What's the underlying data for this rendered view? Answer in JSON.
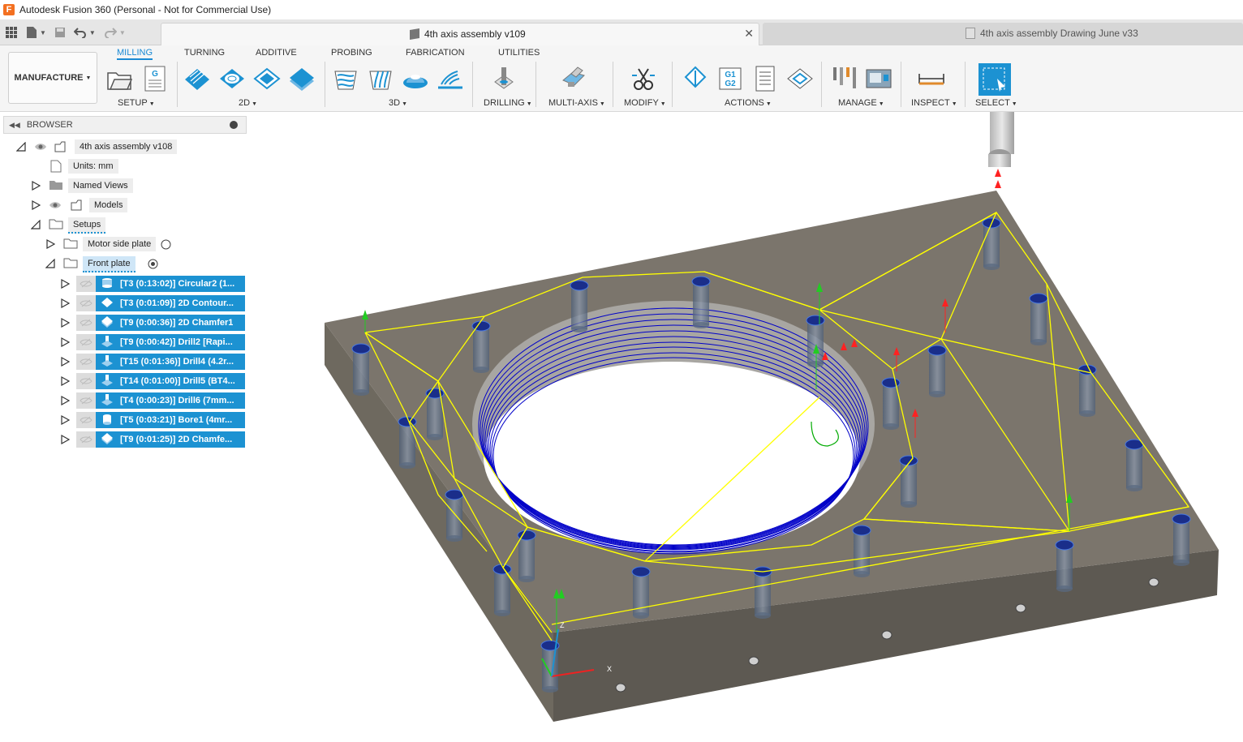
{
  "window": {
    "app_title": "Autodesk Fusion 360 (Personal - Not for Commercial Use)",
    "app_logo_letter": "F"
  },
  "tabs": {
    "active_doc": "4th axis assembly v109",
    "inactive_doc": "4th axis assembly Drawing June v33",
    "close_glyph": "✕"
  },
  "ribbon": {
    "workspace": "MANUFACTURE",
    "tabs": [
      "MILLING",
      "TURNING",
      "ADDITIVE",
      "PROBING",
      "FABRICATION",
      "UTILITIES"
    ],
    "groups": [
      "SETUP",
      "2D",
      "3D",
      "DRILLING",
      "MULTI-AXIS",
      "MODIFY",
      "ACTIONS",
      "MANAGE",
      "INSPECT",
      "SELECT"
    ],
    "actions_g_label": "G1\nG2"
  },
  "browser": {
    "header": "BROWSER",
    "root": "4th axis assembly v108",
    "units": "Units: mm",
    "named_views": "Named Views",
    "models": "Models",
    "setups": "Setups",
    "setup_1": "Motor side plate",
    "setup_2": "Front plate",
    "operations": [
      {
        "label": "[T3 (0:13:02)] Circular2 (1...",
        "icon": "circular-icon"
      },
      {
        "label": "[T3 (0:01:09)] 2D Contour...",
        "icon": "contour-icon"
      },
      {
        "label": "[T9 (0:00:36)] 2D Chamfer1",
        "icon": "chamfer-icon"
      },
      {
        "label": "[T9 (0:00:42)] Drill2 [Rapi...",
        "icon": "drill-icon"
      },
      {
        "label": "[T15 (0:01:36)] Drill4 (4.2r...",
        "icon": "drill-icon"
      },
      {
        "label": "[T14 (0:01:00)] Drill5 (BT4...",
        "icon": "drill-icon"
      },
      {
        "label": "[T4 (0:00:23)] Drill6 (7mm...",
        "icon": "drill-icon"
      },
      {
        "label": "[T5 (0:03:21)] Bore1 (4mr...",
        "icon": "bore-icon"
      },
      {
        "label": "[T9 (0:01:25)] 2D Chamfe...",
        "icon": "chamfer-icon"
      }
    ]
  },
  "viewport": {
    "axis_x_label": "X",
    "axis_z_label": "Z"
  },
  "colors": {
    "accent": "#1c92d2",
    "toolpath_rapid": "#ffff00",
    "toolpath_cut": "#0000c8",
    "plate_top": "#7b756c",
    "plate_front": "#5e5952",
    "plate_right": "#6a655c"
  }
}
